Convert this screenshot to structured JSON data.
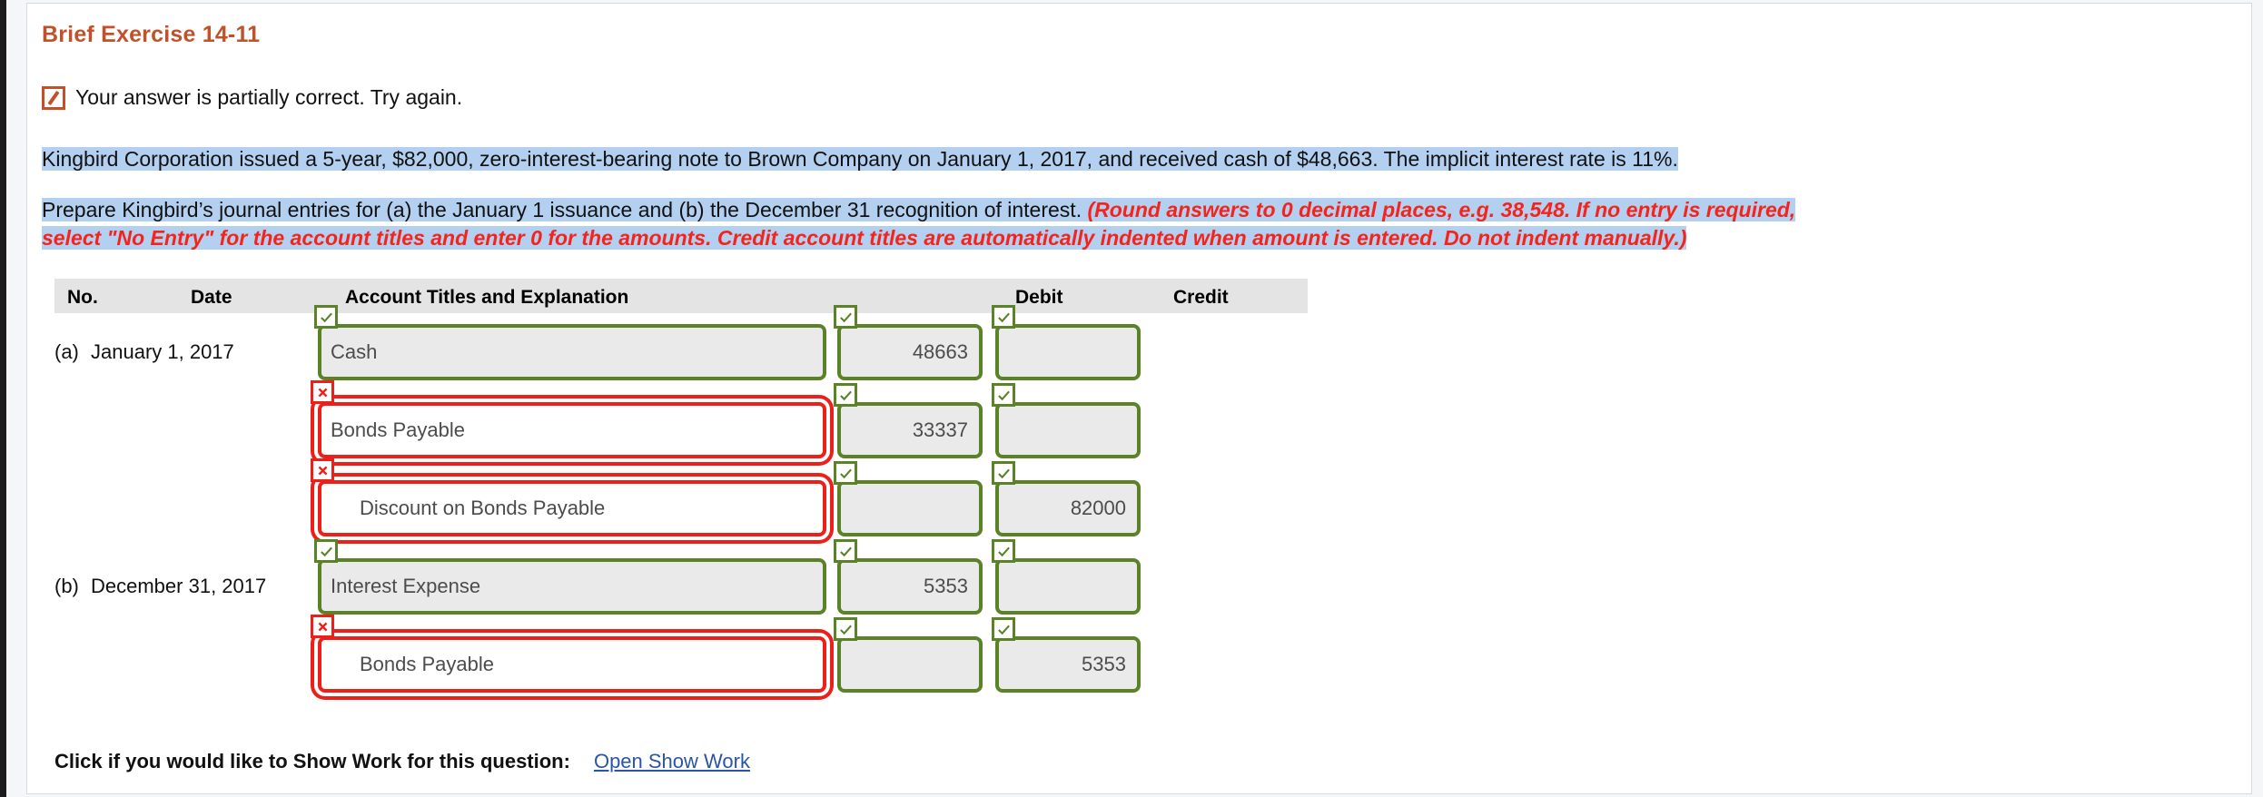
{
  "exercise": {
    "title": "Brief Exercise 14-11",
    "status_text": "Your answer is partially correct.  Try again.",
    "status_icon": "partial-correct-icon"
  },
  "statement": {
    "paragraph1": "Kingbird Corporation issued a 5-year, $82,000, zero-interest-bearing note to Brown Company on January 1, 2017, and received cash of $48,663. The implicit interest rate is 11%.",
    "paragraph2_plain": "Prepare Kingbird’s journal entries for (a) the January 1 issuance and (b) the December 31 recognition of interest. ",
    "paragraph2_red_line1": "(Round answers to 0 decimal places, e.g. 38,548. If no entry is required,",
    "paragraph2_red_line2": "select \"No Entry\" for the account titles and enter 0 for the amounts. Credit account titles are automatically indented when amount is entered. Do not indent manually.)"
  },
  "table": {
    "headers": {
      "no": "No.",
      "date": "Date",
      "account": "Account Titles and Explanation",
      "debit": "Debit",
      "credit": "Credit"
    },
    "rows": [
      {
        "no": "(a)",
        "date": "January 1, 2017",
        "account": "Cash",
        "account_indented": false,
        "account_state": "correct",
        "account_badge": "check-icon",
        "debit": "48663",
        "debit_state": "correct",
        "debit_badge": "check-icon",
        "credit": "",
        "credit_state": "correct",
        "credit_badge": "check-icon"
      },
      {
        "no": "",
        "date": "",
        "account": "Bonds Payable",
        "account_indented": false,
        "account_state": "incorrect",
        "account_badge": "cross-icon",
        "debit": "33337",
        "debit_state": "correct",
        "debit_badge": "check-icon",
        "credit": "",
        "credit_state": "correct",
        "credit_badge": "check-icon"
      },
      {
        "no": "",
        "date": "",
        "account": "Discount on Bonds Payable",
        "account_indented": true,
        "account_state": "incorrect",
        "account_badge": "cross-icon",
        "debit": "",
        "debit_state": "correct",
        "debit_badge": "check-icon",
        "credit": "82000",
        "credit_state": "correct",
        "credit_badge": "check-icon"
      },
      {
        "no": "(b)",
        "date": "December 31, 2017",
        "account": "Interest Expense",
        "account_indented": false,
        "account_state": "correct",
        "account_badge": "check-icon",
        "debit": "5353",
        "debit_state": "correct",
        "debit_badge": "check-icon",
        "credit": "",
        "credit_state": "correct",
        "credit_badge": "check-icon"
      },
      {
        "no": "",
        "date": "",
        "account": "Bonds Payable",
        "account_indented": true,
        "account_state": "incorrect",
        "account_badge": "cross-icon",
        "debit": "",
        "debit_state": "correct",
        "debit_badge": "check-icon",
        "credit": "5353",
        "credit_state": "correct",
        "credit_badge": "check-icon"
      }
    ]
  },
  "footer": {
    "show_work_label": "Click if you would like to Show Work for this question:",
    "show_work_link": "Open Show Work"
  },
  "colors": {
    "title": "#c1502b",
    "correct_border": "#5a8227",
    "incorrect_border": "#ec2019",
    "highlight": "#b4d0f0",
    "instruction_red": "#f5241a",
    "link": "#2b55a3"
  }
}
